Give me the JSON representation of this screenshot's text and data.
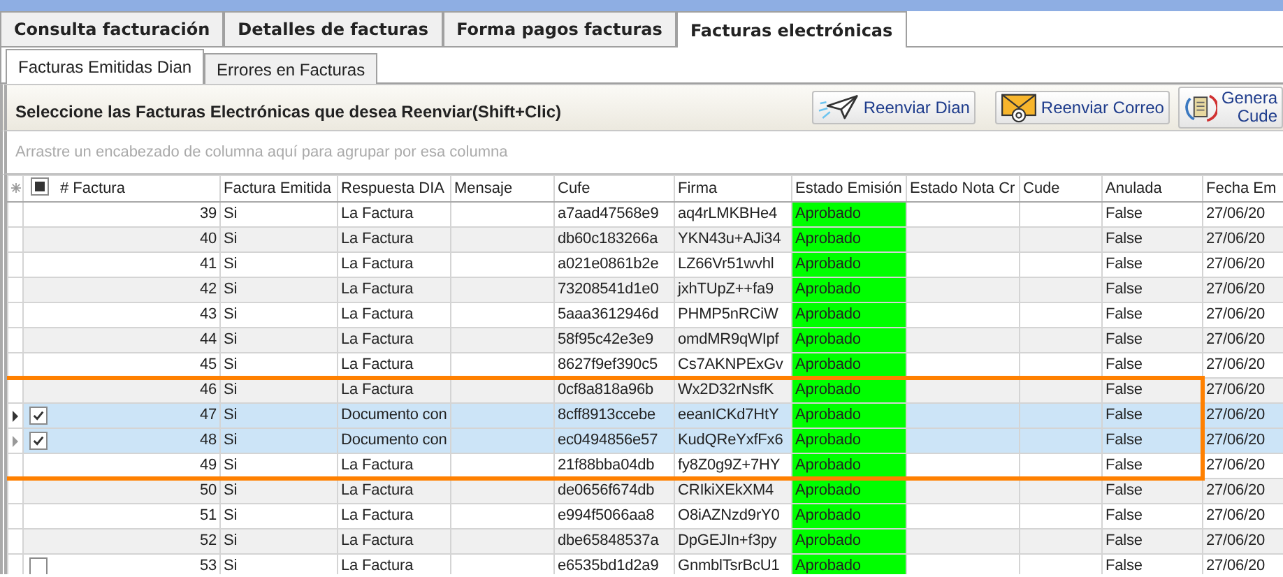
{
  "main_tabs": [
    {
      "label": "Consulta facturación",
      "selected": false
    },
    {
      "label": "Detalles de facturas",
      "selected": false
    },
    {
      "label": "Forma pagos facturas",
      "selected": false
    },
    {
      "label": "Facturas electrónicas",
      "selected": true
    }
  ],
  "sub_tabs": [
    {
      "label": "Facturas Emitidas Dian",
      "selected": true
    },
    {
      "label": "Errores en Facturas",
      "selected": false
    }
  ],
  "toolbar": {
    "title": "Seleccione las Facturas Electrónicas que desea Reenviar(Shift+Clic)",
    "buttons": [
      {
        "kind": "plane",
        "label": "Reenviar Dian"
      },
      {
        "kind": "mail",
        "label": "Reenviar Correo"
      },
      {
        "kind": "cycle",
        "label": "Genera\nCude"
      }
    ]
  },
  "group_panel": {
    "placeholder": "Arrastre un encabezado de columna aquí para agrupar por esa columna"
  },
  "grid": {
    "select_all_partial": true,
    "columns": [
      {
        "label": "# Factura",
        "kind": "number"
      },
      {
        "label": "Factura Emitida",
        "kind": "text"
      },
      {
        "label": "Respuesta DIA",
        "kind": "text"
      },
      {
        "label": "Mensaje",
        "kind": "text"
      },
      {
        "label": "Cufe",
        "kind": "text"
      },
      {
        "label": "Firma",
        "kind": "text"
      },
      {
        "label": "Estado Emisión",
        "kind": "status"
      },
      {
        "label": "Estado Nota Cr",
        "kind": "text"
      },
      {
        "label": "Cude",
        "kind": "text"
      },
      {
        "label": "Anulada",
        "kind": "text"
      },
      {
        "label": "Fecha Em",
        "kind": "text"
      }
    ],
    "rows": [
      {
        "cells": [
          "39",
          "Si",
          "La Factura",
          "",
          "a7aad47568e9",
          "aq4rLMKBHe4",
          "Aprobado",
          "",
          "",
          "False",
          "27/06/20"
        ],
        "selected": false,
        "current": false,
        "outlined": false
      },
      {
        "cells": [
          "40",
          "Si",
          "La Factura",
          "",
          "db60c183266a",
          "YKN43u+AJi34",
          "Aprobado",
          "",
          "",
          "False",
          "27/06/20"
        ],
        "selected": false,
        "current": false,
        "outlined": false
      },
      {
        "cells": [
          "41",
          "Si",
          "La Factura",
          "",
          "a021e0861b2e",
          "LZ66Vr51wvhl",
          "Aprobado",
          "",
          "",
          "False",
          "27/06/20"
        ],
        "selected": false,
        "current": false,
        "outlined": false
      },
      {
        "cells": [
          "42",
          "Si",
          "La Factura",
          "",
          "73208541d1e0",
          "jxhTUpZ++fa9",
          "Aprobado",
          "",
          "",
          "False",
          "27/06/20"
        ],
        "selected": false,
        "current": false,
        "outlined": false
      },
      {
        "cells": [
          "43",
          "Si",
          "La Factura",
          "",
          "5aaa3612946d",
          "PHMP5nRCiW",
          "Aprobado",
          "",
          "",
          "False",
          "27/06/20"
        ],
        "selected": false,
        "current": false,
        "outlined": false
      },
      {
        "cells": [
          "44",
          "Si",
          "La Factura",
          "",
          "58f95c42e3e9",
          "omdMR9qWIpf",
          "Aprobado",
          "",
          "",
          "False",
          "27/06/20"
        ],
        "selected": false,
        "current": false,
        "outlined": false
      },
      {
        "cells": [
          "45",
          "Si",
          "La Factura",
          "",
          "8627f9ef390c5",
          "Cs7AKNPExGv",
          "Aprobado",
          "",
          "",
          "False",
          "27/06/20"
        ],
        "selected": false,
        "current": false,
        "outlined": false
      },
      {
        "cells": [
          "46",
          "Si",
          "La Factura",
          "",
          "0cf8a818a96b",
          "Wx2D32rNsfK",
          "Aprobado",
          "",
          "",
          "False",
          "27/06/20"
        ],
        "selected": false,
        "current": false,
        "outlined": true
      },
      {
        "cells": [
          "47",
          "Si",
          "Documento con",
          "",
          "8cff8913ccebe",
          "eeanICKd7HtY",
          "Aprobado",
          "",
          "",
          "False",
          "27/06/20"
        ],
        "checked": true,
        "selected": true,
        "current": true,
        "outlined": true
      },
      {
        "cells": [
          "48",
          "Si",
          "Documento con",
          "",
          "ec0494856e57",
          "KudQReYxfFx6",
          "Aprobado",
          "",
          "",
          "False",
          "27/06/20"
        ],
        "checked": true,
        "selected": true,
        "current": false,
        "outlined": true
      },
      {
        "cells": [
          "49",
          "Si",
          "La Factura",
          "",
          "21f88bba04db",
          "fy8Z0g9Z+7HY",
          "Aprobado",
          "",
          "",
          "False",
          "27/06/20"
        ],
        "selected": false,
        "current": false,
        "outlined": true
      },
      {
        "cells": [
          "50",
          "Si",
          "La Factura",
          "",
          "de0656f674db",
          "CRIkiXEkXM4",
          "Aprobado",
          "",
          "",
          "False",
          "27/06/20"
        ],
        "selected": false,
        "current": false,
        "outlined": false
      },
      {
        "cells": [
          "51",
          "Si",
          "La Factura",
          "",
          "e994f5066aa8",
          "O8iAZNzd9rY0",
          "Aprobado",
          "",
          "",
          "False",
          "27/06/20"
        ],
        "selected": false,
        "current": false,
        "outlined": false
      },
      {
        "cells": [
          "52",
          "Si",
          "La Factura",
          "",
          "dbe65848537a",
          "DpGEJIn+f3py",
          "Aprobado",
          "",
          "",
          "False",
          "27/06/20"
        ],
        "selected": false,
        "current": false,
        "outlined": false
      },
      {
        "cells": [
          "53",
          "Si",
          "La Factura",
          "",
          "e6535bd1d2a9",
          "GnmblTsrBcU1",
          "Aprobado",
          "",
          "",
          "False",
          "27/06/20"
        ],
        "checked": false,
        "selected": false,
        "current": false,
        "outlined": false
      }
    ]
  }
}
